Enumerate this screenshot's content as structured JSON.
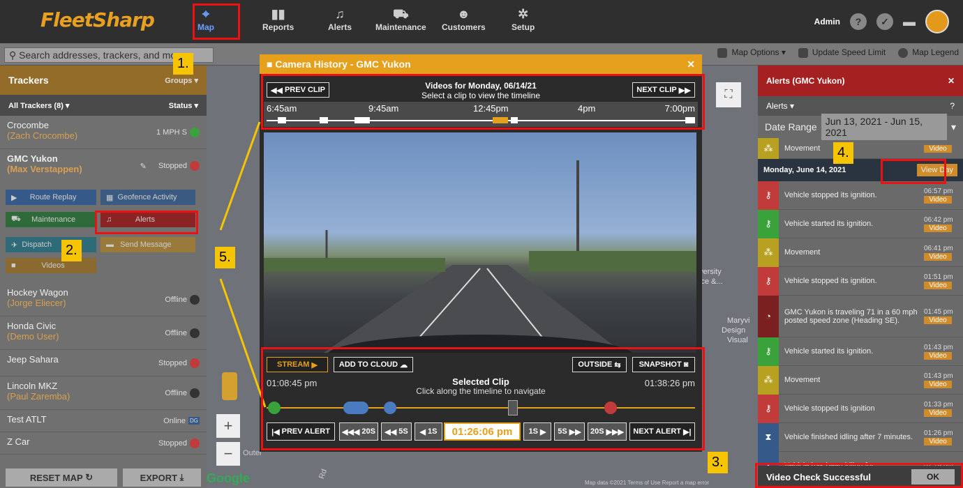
{
  "app": {
    "logo": "FleetSharp"
  },
  "nav": [
    {
      "label": "Map",
      "icon": "map-icon"
    },
    {
      "label": "Reports",
      "icon": "bar-chart-icon"
    },
    {
      "label": "Alerts",
      "icon": "bell-icon"
    },
    {
      "label": "Maintenance",
      "icon": "car-icon"
    },
    {
      "label": "Customers",
      "icon": "people-icon"
    },
    {
      "label": "Setup",
      "icon": "gear-icon"
    }
  ],
  "user": {
    "name": "Admin"
  },
  "search": {
    "placeholder": "Search addresses, trackers, and mo"
  },
  "mapbar": {
    "options": "Map Options",
    "speed": "Update Speed Limit",
    "legend": "Map Legend"
  },
  "sidebar": {
    "title": "Trackers",
    "groups": "Groups",
    "all": "All Trackers (8)",
    "status": "Status",
    "trackers": [
      {
        "name": "Crocombe",
        "driver": "(Zach Crocombe)",
        "status": "1 MPH S"
      },
      {
        "name": "GMC Yukon",
        "driver": "(Max Verstappen)",
        "status": "Stopped"
      },
      {
        "name": "Hockey Wagon",
        "driver": "(Jorge Eliecer)",
        "status": "Offline"
      },
      {
        "name": "Honda Civic",
        "driver": "(Demo User)",
        "status": "Offline"
      },
      {
        "name": "Jeep Sahara",
        "driver": "",
        "status": "Stopped"
      },
      {
        "name": "Lincoln MKZ",
        "driver": "(Paul Zaremba)",
        "status": "Offline"
      },
      {
        "name": "Test ATLT",
        "driver": "",
        "status": "Online"
      },
      {
        "name": "Z Car",
        "driver": "",
        "status": "Stopped"
      }
    ],
    "actions": {
      "route": "Route Replay",
      "geofence": "Geofence Activity",
      "maintenance": "Maintenance",
      "alerts": "Alerts",
      "dispatch": "Dispatch",
      "send": "Send Message",
      "videos": "Videos"
    },
    "reset": "RESET MAP",
    "export": "EXPORT"
  },
  "modal": {
    "title": "Camera History - GMC Yukon",
    "prev": "PREV CLIP",
    "next": "NEXT CLIP",
    "heading": "Videos for Monday, 06/14/21",
    "sub": "Select a clip to view the timeline",
    "ticks": [
      "6:45am",
      "9:45am",
      "12:45pm",
      "4pm",
      "7:00pm"
    ],
    "stream": "STREAM",
    "cloud": "ADD TO CLOUD",
    "outside": "OUTSIDE",
    "snapshot": "SNAPSHOT",
    "start": "01:08:45 pm",
    "end": "01:38:26 pm",
    "clip": "Selected Clip",
    "clipsub": "Click along the timeline to navigate",
    "prevAlert": "PREV ALERT",
    "b20": "20S",
    "b5": "5S",
    "b1": "1S",
    "time": "01:26:06 pm",
    "f1": "1S",
    "f5": "5S",
    "f20": "20S",
    "nextAlert": "NEXT ALERT"
  },
  "alerts": {
    "title": "Alerts (GMC Yukon)",
    "filter": "Alerts",
    "range_label": "Date Range",
    "range": "Jun 13, 2021 - Jun 15, 2021",
    "top": {
      "text": "Movement",
      "video": "Video"
    },
    "day": "Monday, June 14, 2021",
    "viewday": "View Day",
    "rows": [
      {
        "text": "Vehicle stopped its ignition.",
        "time": "06:57 pm",
        "video": "Video",
        "color": "#c23b3b",
        "icon": "key-icon"
      },
      {
        "text": "Vehicle started its ignition.",
        "time": "06:42 pm",
        "video": "Video",
        "color": "#3aa23a",
        "icon": "key-icon"
      },
      {
        "text": "Movement",
        "time": "06:41 pm",
        "video": "Video",
        "color": "#b8a020",
        "icon": "footprints-icon"
      },
      {
        "text": "Vehicle stopped its ignition.",
        "time": "01:51 pm",
        "video": "Video",
        "color": "#c23b3b",
        "icon": "key-icon"
      },
      {
        "text": "GMC Yukon is traveling 71 in a 60 mph posted speed zone (Heading SE).",
        "time": "01:45 pm",
        "video": "Video",
        "color": "#7a2020",
        "icon": "speedometer-icon"
      },
      {
        "text": "Vehicle started its ignition.",
        "time": "01:43 pm",
        "video": "Video",
        "color": "#3aa23a",
        "icon": "key-icon"
      },
      {
        "text": "Movement",
        "time": "01:43 pm",
        "video": "Video",
        "color": "#b8a020",
        "icon": "footprints-icon"
      },
      {
        "text": "Vehicle stopped its ignition",
        "time": "01:33 pm",
        "video": "Video",
        "color": "#c23b3b",
        "icon": "key-icon"
      },
      {
        "text": "Vehicle finished idling after 7 minutes.",
        "time": "01:26 pm",
        "video": "Video",
        "color": "#355a8a",
        "icon": "hourglass-icon"
      },
      {
        "text": "Vehicle has been idling for",
        "time": "01:19 pm",
        "video": "",
        "color": "#355a8a",
        "icon": "hourglass-icon"
      }
    ]
  },
  "toast": {
    "text": "Video Check Successful",
    "ok": "OK"
  },
  "map": {
    "poi1": "versity",
    "poi2": "ice &...",
    "poi3": "Maryvi",
    "poi4": "Design",
    "poi5": "Visual",
    "road": "Rd",
    "outer": "Outer",
    "google": "Google",
    "footer": "Map data ©2021   Terms of Use   Report a map error"
  },
  "steps": [
    "1.",
    "2.",
    "3.",
    "4.",
    "5."
  ]
}
